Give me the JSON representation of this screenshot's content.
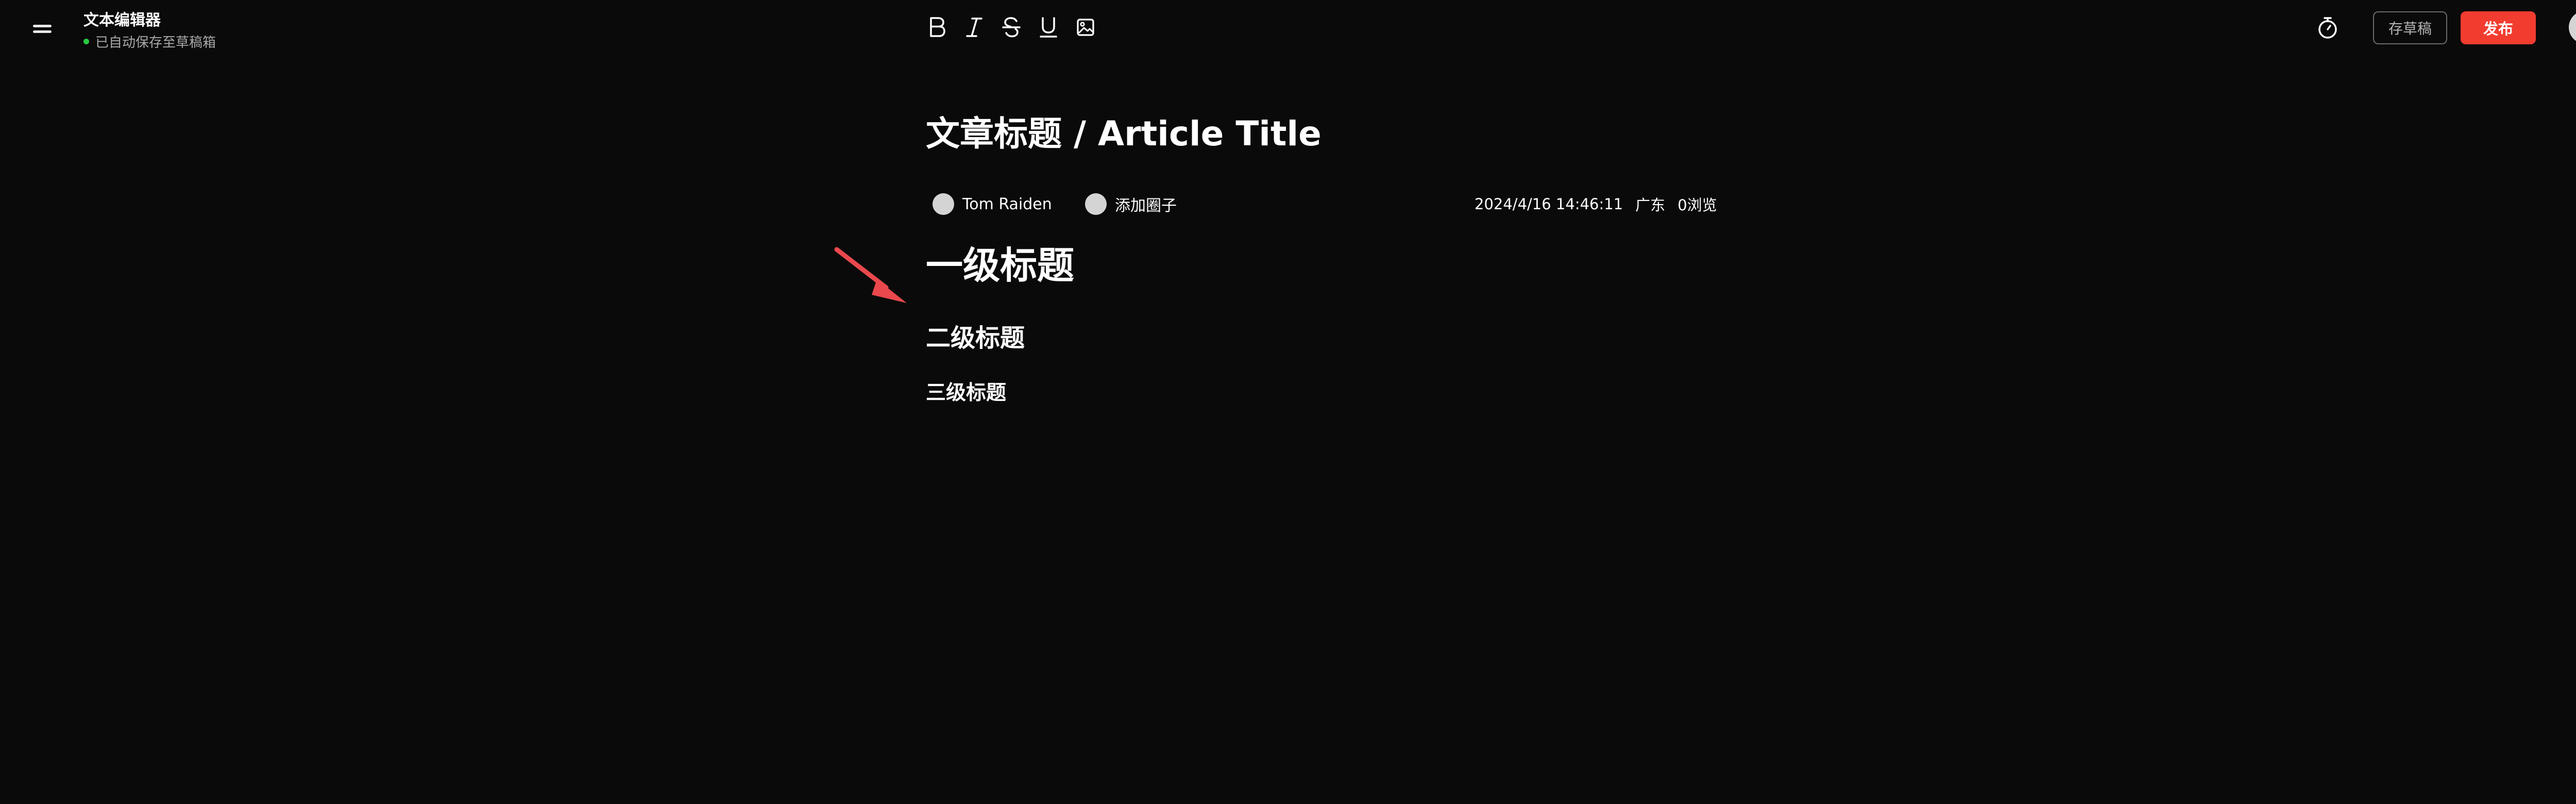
{
  "header": {
    "app_title": "文本编辑器",
    "save_status": "已自动保存至草稿箱",
    "status_color": "#28c840",
    "menu_icon": "menu-icon"
  },
  "toolbar": {
    "tools": [
      {
        "name": "bold",
        "icon": "bold-icon"
      },
      {
        "name": "italic",
        "icon": "italic-icon"
      },
      {
        "name": "strikethrough",
        "icon": "strikethrough-icon"
      },
      {
        "name": "underline",
        "icon": "underline-icon"
      },
      {
        "name": "image",
        "icon": "image-icon"
      }
    ]
  },
  "actions": {
    "timer_icon": "timer-icon",
    "draft_label": "存草稿",
    "publish_label": "发布",
    "publish_color": "#f23c2f"
  },
  "article": {
    "title": "文章标题 / Article Title",
    "author": "Tom Raiden",
    "circle": "添加圈子",
    "datetime": "2024/4/16 14:46:11",
    "location": "广东",
    "views": "0浏览",
    "h1": "一级标题",
    "h2": "二级标题",
    "h3": "三级标题"
  },
  "annotation": {
    "arrow_color": "#e9484d"
  }
}
